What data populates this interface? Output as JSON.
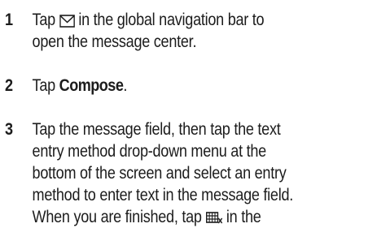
{
  "steps": [
    {
      "number": "1",
      "line1_before_icon": "Tap",
      "icon": "envelope-icon",
      "line1_after_icon": "in the global navigation bar to",
      "line2": "open the message center."
    },
    {
      "number": "2",
      "before": "Tap",
      "bold": "Compose",
      "after": "."
    },
    {
      "number": "3",
      "lines": [
        "Tap the message field, then tap the text",
        "entry method drop-down menu at the",
        "bottom of the screen and select an entry",
        "method to enter text in the message field."
      ],
      "last_before_icon": "When you are finished, tap",
      "icon": "keyboard-close-icon",
      "last_after_icon": "in the"
    }
  ]
}
